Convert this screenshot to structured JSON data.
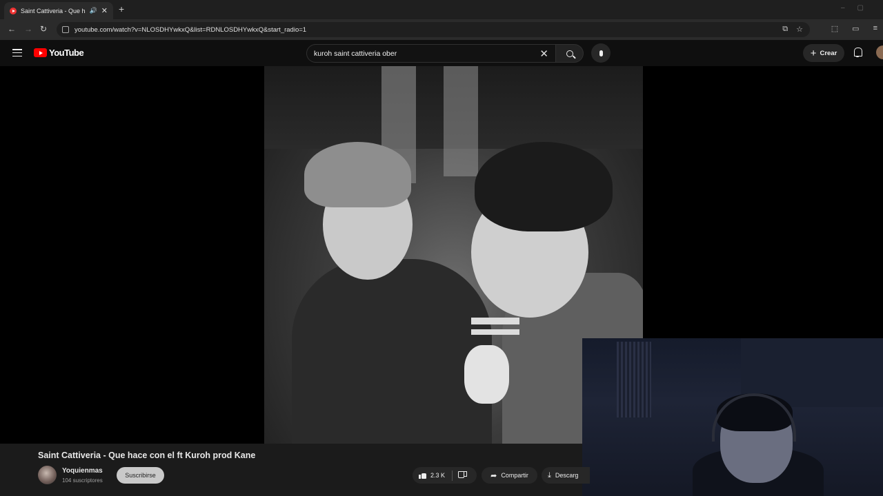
{
  "browser": {
    "tab_title": "Saint Cattiveria - Que hace",
    "tab_audio_icon": "speaker-icon",
    "tab_close": "✕",
    "new_tab": "+",
    "url": "youtube.com/watch?v=NLOSDHYwkxQ&list=RDNLOSDHYwkxQ&start_radio=1"
  },
  "youtube": {
    "logo_text": "YouTube",
    "search_value": "kuroh saint cattiveria ober",
    "create_label": "Crear",
    "accent": "#ff0000"
  },
  "video": {
    "title": "Saint Cattiveria - Que hace con el ft Kuroh prod Kane",
    "channel_name": "Yoquienmas",
    "channel_subs": "104 suscriptores",
    "subscribe_label": "Suscribirse",
    "like_count": "2.3 K",
    "share_label": "Compartir",
    "download_label": "Descarg"
  }
}
